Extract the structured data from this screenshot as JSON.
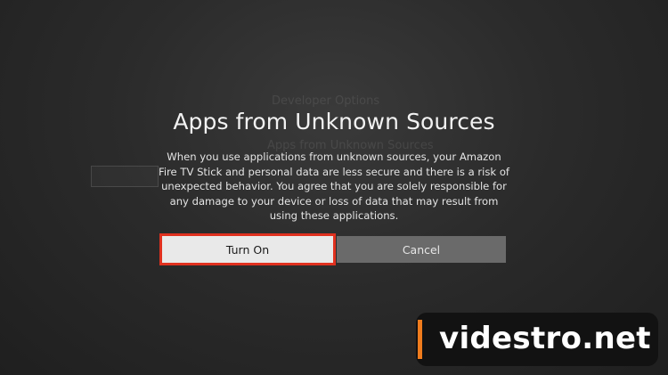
{
  "background": {
    "section_heading": "Developer Options",
    "list_item": "Apps from Unknown Sources",
    "right_panel_line1": "",
    "right_panel_line2": "",
    "left_box": "",
    "left_label": ""
  },
  "dialog": {
    "title": "Apps from Unknown Sources",
    "message": "When you use applications from unknown sources, your Amazon Fire TV Stick and personal data are less secure and there is a risk of unexpected behavior. You agree that you are solely responsible for any damage to your device or loss of data that may result from using these applications.",
    "turn_on_label": "Turn On",
    "cancel_label": "Cancel",
    "highlight_color": "#e0311f"
  },
  "watermark": {
    "text": "videstro.net",
    "accent_color": "#f07c1d"
  }
}
